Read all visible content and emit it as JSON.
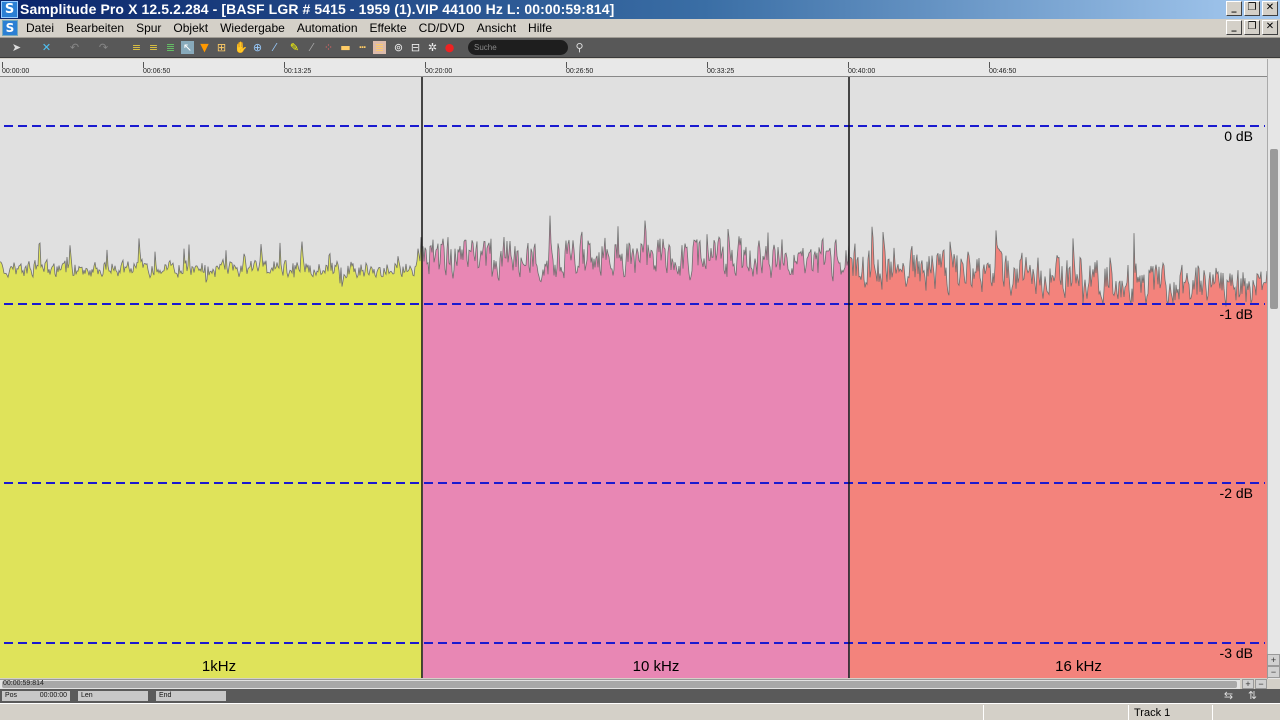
{
  "window": {
    "title": "Samplitude Pro X 12.5.2.284 - [BASF LGR # 5415 - 1959 (1).VIP   44100 Hz L: 00:00:59:814]",
    "app_icon": "S"
  },
  "menu": [
    "Datei",
    "Bearbeiten",
    "Spur",
    "Objekt",
    "Wiedergabe",
    "Automation",
    "Effekte",
    "CD/DVD",
    "Ansicht",
    "Hilfe"
  ],
  "toolbar": {
    "search_placeholder": "Suche"
  },
  "ruler": {
    "ticks": [
      "00:00:00",
      "00:06:50",
      "00:13:25",
      "00:20:00",
      "00:26:50",
      "00:33:25",
      "00:40:00",
      "00:46:50"
    ]
  },
  "db_labels": [
    "0 dB",
    "-1 dB",
    "-2 dB",
    "-3 dB"
  ],
  "segments": [
    {
      "label": "1kHz",
      "color": "#dfe35a"
    },
    {
      "label": "10 kHz",
      "color": "#e887b4"
    },
    {
      "label": "16 kHz",
      "color": "#f3837c"
    }
  ],
  "guide_color": "#1a1ad0",
  "hscroll": {
    "position": "00:00:59:814"
  },
  "status": {
    "pos_label": "Pos",
    "pos_value": "00:00:00",
    "len_label": "Len",
    "end_label": "End",
    "track": "Track 1"
  }
}
